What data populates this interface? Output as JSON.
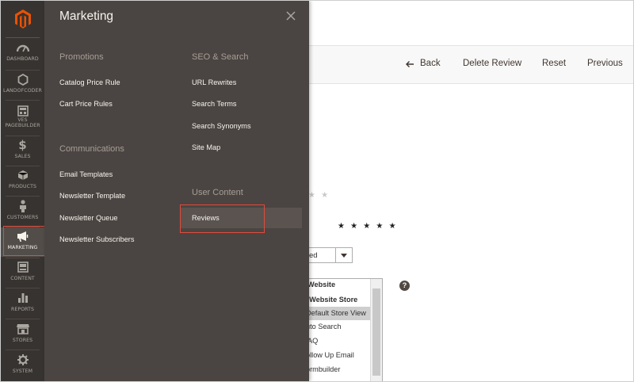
{
  "sidebar": {
    "logo_icon": "magento-logo-icon",
    "items": [
      {
        "label": "DASHBOARD",
        "icon": "dashboard-icon"
      },
      {
        "label": "LANDOFCODER",
        "icon": "hexagon-icon"
      },
      {
        "label": "VES PAGEBUILDER",
        "icon": "pagebuilder-icon"
      },
      {
        "label": "SALES",
        "icon": "dollar-icon"
      },
      {
        "label": "PRODUCTS",
        "icon": "box-icon"
      },
      {
        "label": "CUSTOMERS",
        "icon": "person-icon"
      },
      {
        "label": "MARKETING",
        "icon": "megaphone-icon"
      },
      {
        "label": "CONTENT",
        "icon": "content-icon"
      },
      {
        "label": "REPORTS",
        "icon": "bar-chart-icon"
      },
      {
        "label": "STORES",
        "icon": "store-icon"
      },
      {
        "label": "SYSTEM",
        "icon": "gear-icon"
      }
    ],
    "active": "MARKETING"
  },
  "flyout": {
    "title": "Marketing",
    "close_icon": "close-icon",
    "groups": {
      "promotions": {
        "title": "Promotions",
        "items": [
          "Catalog Price Rule",
          "Cart Price Rules"
        ]
      },
      "communications": {
        "title": "Communications",
        "items": [
          "Email Templates",
          "Newsletter Template",
          "Newsletter Queue",
          "Newsletter Subscribers"
        ]
      },
      "seo": {
        "title": "SEO & Search",
        "items": [
          "URL Rewrites",
          "Search Terms",
          "Search Synonyms",
          "Site Map"
        ]
      },
      "user_content": {
        "title": "User Content",
        "items": [
          "Reviews"
        ]
      }
    },
    "highlighted_item": "Reviews"
  },
  "page": {
    "actions": {
      "back": "Back",
      "delete": "Delete Review",
      "reset": "Reset",
      "previous": "Previous"
    },
    "rating_stars_faded": "★ ★",
    "rating_stars": "★ ★ ★ ★ ★",
    "status_select_value": "ed",
    "help_glyph": "?",
    "store_list": [
      {
        "label": "Website",
        "style": "bold"
      },
      {
        "label": "n Website Store",
        "style": "bold"
      },
      {
        "label": "Default Store View",
        "style": "selected"
      },
      {
        "label": "uto Search",
        "style": "normal"
      },
      {
        "label": "AQ",
        "style": "normal"
      },
      {
        "label": "ollow Up Email",
        "style": "normal"
      },
      {
        "label": "ormbuilder",
        "style": "normal"
      },
      {
        "label": "...",
        "style": "normal"
      }
    ]
  },
  "colors": {
    "sidebar_bg": "#373330",
    "flyout_bg": "#4a4542",
    "logo_orange": "#eb5202",
    "highlight_red": "#e14b3b"
  }
}
